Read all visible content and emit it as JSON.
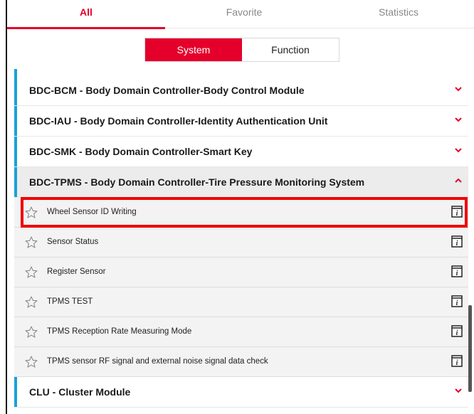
{
  "tabs": [
    {
      "label": "All",
      "active": true
    },
    {
      "label": "Favorite",
      "active": false
    },
    {
      "label": "Statistics",
      "active": false
    }
  ],
  "segments": {
    "system": "System",
    "function": "Function",
    "active": "System"
  },
  "groups": [
    {
      "title": "BDC-BCM - Body Domain Controller-Body Control Module",
      "expanded": false
    },
    {
      "title": "BDC-IAU - Body Domain Controller-Identity Authentication Unit",
      "expanded": false
    },
    {
      "title": "BDC-SMK - Body Domain Controller-Smart Key",
      "expanded": false
    },
    {
      "title": "BDC-TPMS - Body Domain Controller-Tire Pressure Monitoring System",
      "expanded": true
    },
    {
      "title": "CLU - Cluster Module",
      "expanded": false
    }
  ],
  "tpms_items": [
    "Wheel Sensor ID Writing",
    "Sensor Status",
    "Register Sensor",
    "TPMS TEST",
    "TPMS Reception Rate Measuring Mode",
    "TPMS sensor RF signal and external noise signal data check"
  ],
  "highlighted_item": "Wheel Sensor ID Writing",
  "icons": {
    "favorite": "star-outline-icon",
    "info": "info-book-icon",
    "expand": "chevron-down-icon",
    "collapse": "chevron-up-icon"
  },
  "colors": {
    "accent": "#e4002b",
    "group_bar": "#1aa1d8",
    "highlight": "#ee0000"
  }
}
